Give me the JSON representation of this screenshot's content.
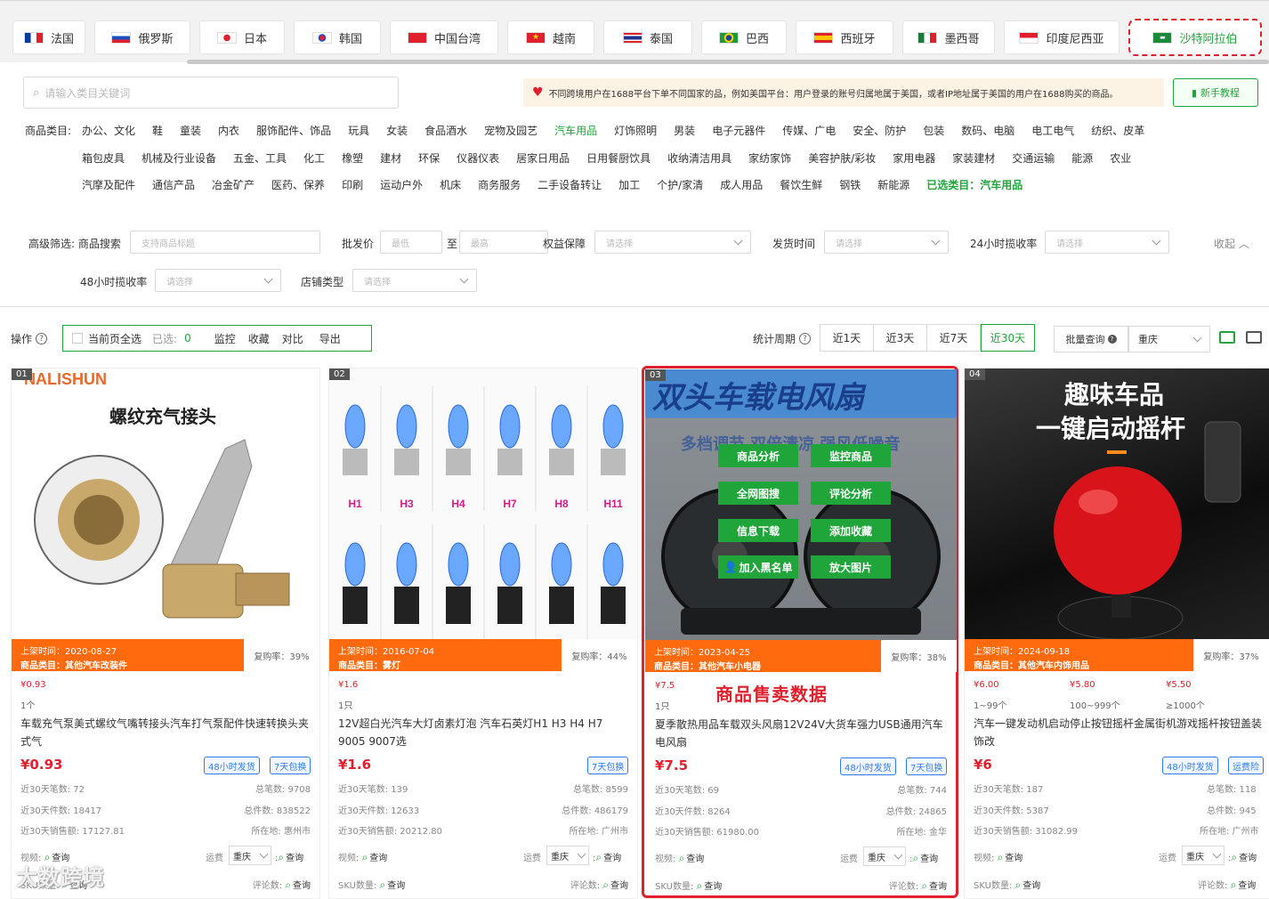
{
  "countries": [
    {
      "label": "法国",
      "flag": "flag-france-icon"
    },
    {
      "label": "俄罗斯",
      "flag": "flag-russia-icon"
    },
    {
      "label": "日本",
      "flag": "flag-japan-icon"
    },
    {
      "label": "韩国",
      "flag": "flag-korea-icon"
    },
    {
      "label": "中国台湾",
      "flag": "flag-taiwan-icon"
    },
    {
      "label": "越南",
      "flag": "flag-vietnam-icon"
    },
    {
      "label": "泰国",
      "flag": "flag-thailand-icon"
    },
    {
      "label": "巴西",
      "flag": "flag-brazil-icon"
    },
    {
      "label": "西班牙",
      "flag": "flag-spain-icon"
    },
    {
      "label": "墨西哥",
      "flag": "flag-mexico-icon"
    },
    {
      "label": "印度尼西亚",
      "flag": "flag-indonesia-icon"
    },
    {
      "label": "沙特阿拉伯",
      "flag": "flag-saudi-icon",
      "active": true
    }
  ],
  "search": {
    "placeholder": "请输入类目关键词"
  },
  "notice": {
    "text": "不同跨境用户在1688平台下单不同国家的品，例如美国平台：用户登录的账号归属地属于美国，或者IP地址属于美国的用户在1688购买的商品。"
  },
  "tutorial": {
    "label": "新手教程"
  },
  "categories": {
    "label": "商品类目:",
    "rows": [
      [
        "办公、文化",
        "鞋",
        "童装",
        "内衣",
        "服饰配件、饰品",
        "玩具",
        "女装",
        "食品酒水",
        "宠物及园艺",
        "汽车用品",
        "灯饰照明",
        "男装",
        "电子元器件",
        "传媒、广电",
        "安全、防护",
        "包装",
        "数码、电脑",
        "电工电气",
        "纺织、皮革"
      ],
      [
        "箱包皮具",
        "机械及行业设备",
        "五金、工具",
        "化工",
        "橡塑",
        "建材",
        "环保",
        "仪器仪表",
        "居家日用品",
        "日用餐厨饮具",
        "收纳清洁用具",
        "家纺家饰",
        "美容护肤/彩妆",
        "家用电器",
        "家装建材",
        "交通运输",
        "能源",
        "农业"
      ],
      [
        "汽摩及配件",
        "通信产品",
        "冶金矿产",
        "医药、保养",
        "印刷",
        "运动户外",
        "机床",
        "商务服务",
        "二手设备转让",
        "加工",
        "个护/家清",
        "成人用品",
        "餐饮生鲜",
        "钢铁",
        "新能源"
      ]
    ],
    "selected": "汽车用品",
    "chosen_text": "已选类目：汽车用品"
  },
  "filters": {
    "advanced_label": "高级筛选:",
    "product_search_label": "商品搜索",
    "product_search_placeholder": "支持商品标题",
    "wholesale_label": "批发价",
    "min_placeholder": "最低",
    "to": "至",
    "max_placeholder": "最高",
    "rights_label": "权益保障",
    "ship_time_label": "发货时间",
    "pickup24_label": "24小时揽收率",
    "collapse": "收起",
    "pickup48_label": "48小时揽收率",
    "shop_type_label": "店铺类型",
    "select_placeholder": "请选择"
  },
  "toolbar": {
    "op_label": "操作",
    "select_all": "当前页全选",
    "selected_label": "已选:",
    "selected_count": "0",
    "actions": [
      "监控",
      "收藏",
      "对比",
      "导出"
    ],
    "period_label": "统计周期",
    "periods": [
      "近1天",
      "近3天",
      "近7天",
      "近30天"
    ],
    "active_period": "近30天",
    "batch_query": "批量查询",
    "city": "重庆"
  },
  "cards": [
    {
      "rank": "01",
      "brand_text": "NALISHUN",
      "image_caption": "螺纹充气接头",
      "listed": "上架时间：2020-08-27",
      "category": "商品类目：其他汽车改装件",
      "repurchase": "复购率：39%",
      "tiers": [
        {
          "price": "¥0.93",
          "qty": "1个"
        }
      ],
      "title": "车载充气泵美式螺纹气嘴转接头汽车打气泵配件快速转换头夹式气",
      "big_price": "¥0.93",
      "tags": [
        "48小时发货",
        "7天包换"
      ],
      "orders30": "近30天笔数: 72",
      "orders_total": "总笔数: 9708",
      "pieces30": "近30天件数: 18417",
      "pieces_total": "总件数: 838522",
      "sales30": "近30天销售额: 17127.81",
      "location": "所在地: 惠州市",
      "video": "视频:",
      "query": "查询",
      "freight": "运费",
      "city": "重庆",
      "sku": "SKU数量:",
      "reviews": "评论数:"
    },
    {
      "rank": "02",
      "bulb_labels": [
        "H1",
        "H3",
        "H4",
        "H7",
        "H8",
        "H11"
      ],
      "listed": "上架时间：2016-07-04",
      "category": "商品类目：雾灯",
      "repurchase": "复购率：44%",
      "tiers": [
        {
          "price": "¥1.6",
          "qty": "1只"
        }
      ],
      "title": "12V超白光汽车大灯卤素灯泡 汽车石英灯H1 H3 H4 H7 9005 9007选",
      "big_price": "¥1.6",
      "tags": [
        "7天包换"
      ],
      "orders30": "近30天笔数: 139",
      "orders_total": "总笔数: 8599",
      "pieces30": "近30天件数: 12633",
      "pieces_total": "总件数: 486179",
      "sales30": "近30天销售额: 20212.80",
      "location": "所在地: 广州市",
      "video": "视频:",
      "query": "查询",
      "freight": "运费",
      "city": "重庆",
      "sku": "SKU数量:",
      "reviews": "评论数:"
    },
    {
      "rank": "03",
      "image_caption": "双头车载电风扇",
      "image_sub": "多档调节 双倍清凉 强风低噪音",
      "overlay": [
        "商品分析",
        "监控商品",
        "全网图搜",
        "评论分析",
        "信息下载",
        "添加收藏",
        "加入黑名单",
        "放大图片"
      ],
      "listed": "上架时间：2023-04-25",
      "category": "商品类目：其他汽车小电器",
      "repurchase": "复购率：38%",
      "sales_label": "商品售卖数据",
      "tiers": [
        {
          "price": "¥7.5",
          "qty": "1只"
        }
      ],
      "title": "夏季散热用品车载双头风扇12V24V大货车强力USB通用汽车电风扇",
      "big_price": "¥7.5",
      "tags": [
        "48小时发货",
        "7天包换"
      ],
      "orders30": "近30天笔数: 69",
      "orders_total": "总笔数: 744",
      "pieces30": "近30天件数: 8264",
      "pieces_total": "总件数: 24865",
      "sales30": "近30天销售额: 61980.00",
      "location": "所在地: 金华",
      "video": "视频:",
      "query": "查询",
      "freight": "运费",
      "city": "重庆",
      "sku": "SKU数量:",
      "reviews": "评论数:"
    },
    {
      "rank": "04",
      "image_caption": "趣味车品",
      "image_sub": "一键启动摇杆",
      "listed": "上架时间：2024-09-18",
      "category": "商品类目：其他汽车内饰用品",
      "repurchase": "复购率：37%",
      "tiers": [
        {
          "price": "¥6.00",
          "qty": "1~99个"
        },
        {
          "price": "¥5.80",
          "qty": "100~999个"
        },
        {
          "price": "¥5.50",
          "qty": "≥1000个"
        }
      ],
      "title": "汽车一键发动机启动停止按钮摇杆金属街机游戏摇杆按钮盖装饰改",
      "big_price": "¥6",
      "tags": [
        "48小时发货",
        "运费险"
      ],
      "orders30": "近30天笔数: 187",
      "orders_total": "总笔数: 118",
      "pieces30": "近30天件数: 5387",
      "pieces_total": "总件数: 945",
      "sales30": "近30天销售额: 31082.99",
      "location": "所在地: 广州市",
      "video": "视频:",
      "query": "查询",
      "freight": "运费",
      "city": "重庆",
      "sku": "SKU数量:",
      "reviews": "评论数:"
    }
  ],
  "watermark": "大数跨境",
  "colors": {
    "accent": "#1fa53a",
    "highlight": "#e0202c",
    "info_bar": "#ff6a0e",
    "tag": "#2f7cf6"
  }
}
